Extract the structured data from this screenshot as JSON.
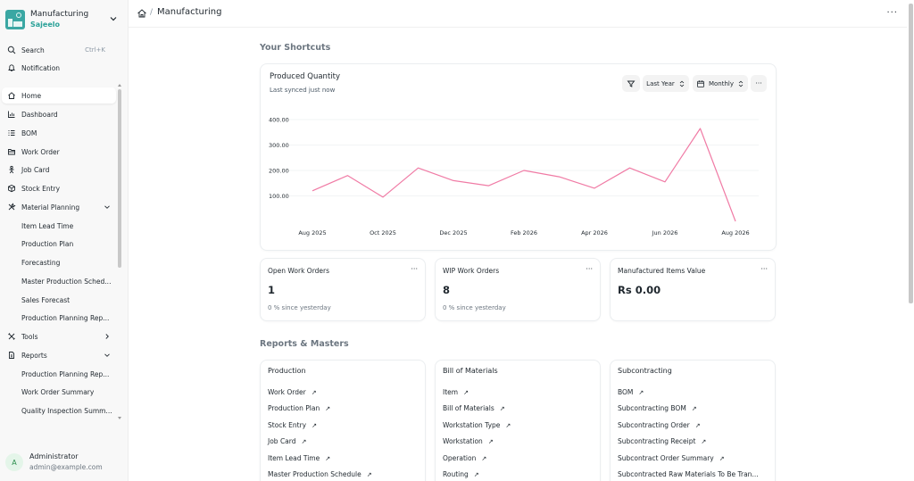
{
  "app": {
    "title": "Manufacturing",
    "site": "Sajeelo"
  },
  "sidebar": {
    "search": {
      "label": "Search",
      "shortcut": "Ctrl+K"
    },
    "notification": {
      "label": "Notification"
    },
    "items": [
      {
        "label": "Home",
        "icon": "home-icon"
      },
      {
        "label": "Dashboard",
        "icon": "chart-icon"
      },
      {
        "label": "BOM",
        "icon": "list-icon"
      },
      {
        "label": "Work Order",
        "icon": "folder-icon"
      },
      {
        "label": "Job Card",
        "icon": "person-icon"
      },
      {
        "label": "Stock Entry",
        "icon": "box-icon"
      },
      {
        "label": "Material Planning",
        "icon": "tools-icon"
      },
      {
        "label": "Item Lead Time"
      },
      {
        "label": "Production Plan"
      },
      {
        "label": "Forecasting"
      },
      {
        "label": "Master Production Sched..."
      },
      {
        "label": "Sales Forecast"
      },
      {
        "label": "Production Planning Rep..."
      },
      {
        "label": "Tools",
        "icon": "wrench-icon"
      },
      {
        "label": "Reports",
        "icon": "file-icon"
      },
      {
        "label": "Production Planning Rep..."
      },
      {
        "label": "Work Order Summary"
      },
      {
        "label": "Quality Inspection Summ..."
      }
    ]
  },
  "user": {
    "initial": "A",
    "name": "Administrator",
    "email": "admin@example.com"
  },
  "breadcrumb": {
    "current": "Manufacturing"
  },
  "shortcuts": {
    "title": "Your Shortcuts",
    "chart": {
      "title": "Produced Quantity",
      "subtitle": "Last synced just now",
      "period": "Last Year",
      "interval": "Monthly"
    }
  },
  "chart_data": {
    "type": "line",
    "title": "Produced Quantity",
    "x": [
      "Aug 2025",
      "Sep 2025",
      "Oct 2025",
      "Nov 2025",
      "Dec 2025",
      "Jan 2026",
      "Feb 2026",
      "Mar 2026",
      "Apr 2026",
      "May 2026",
      "Jun 2026",
      "Jul 2026",
      "Aug 2026"
    ],
    "x_tick_labels": [
      "Aug 2025",
      "Oct 2025",
      "Dec 2025",
      "Feb 2026",
      "Apr 2026",
      "Jun 2026",
      "Aug 2026"
    ],
    "y_ticks": [
      100,
      200,
      300,
      400
    ],
    "y_tick_labels": [
      "100.00",
      "200.00",
      "300.00",
      "400.00"
    ],
    "ylim": [
      0,
      400
    ],
    "series": [
      {
        "values": [
          120,
          180,
          95,
          210,
          160,
          140,
          200,
          175,
          130,
          210,
          155,
          365,
          0
        ]
      }
    ],
    "color": "#f07ba5",
    "grid": true
  },
  "number_cards": [
    {
      "title": "Open Work Orders",
      "value": "1",
      "delta": "0 % since yesterday"
    },
    {
      "title": "WIP Work Orders",
      "value": "8",
      "delta": "0 % since yesterday"
    },
    {
      "title": "Manufactured Items Value",
      "value": "Rs 0.00",
      "delta": ""
    }
  ],
  "reports": {
    "title": "Reports & Masters",
    "cards": [
      {
        "title": "Production",
        "links": [
          "Work Order",
          "Production Plan",
          "Stock Entry",
          "Job Card",
          "Item Lead Time",
          "Master Production Schedule"
        ]
      },
      {
        "title": "Bill of Materials",
        "links": [
          "Item",
          "Bill of Materials",
          "Workstation Type",
          "Workstation",
          "Operation",
          "Routing"
        ]
      },
      {
        "title": "Subcontracting",
        "links": [
          "BOM",
          "Subcontracting BOM",
          "Subcontracting Order",
          "Subcontracting Receipt",
          "Subcontract Order Summary",
          "Subcontracted Raw Materials To Be Tran..."
        ]
      }
    ]
  }
}
